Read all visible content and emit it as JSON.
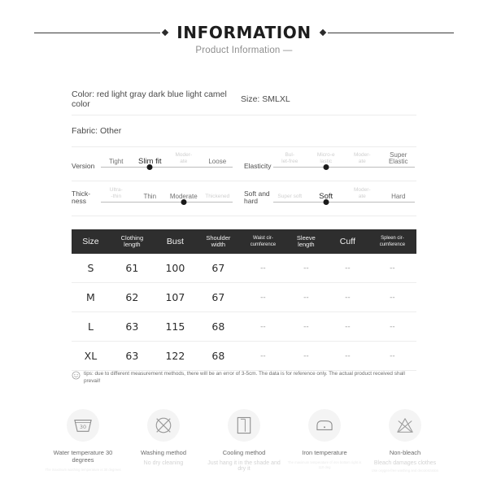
{
  "header": {
    "title": "INFORMATION",
    "subtitle": "Product Information —"
  },
  "info": {
    "color": "Color: red light gray dark blue light camel color",
    "size": "Size: SMLXL",
    "fabric": "Fabric: Other"
  },
  "attributes": [
    {
      "label": "Version",
      "ticks": [
        "Tight",
        "Slim fit",
        "Moder-\nate",
        "Loose"
      ],
      "selected_index": 1,
      "styles": [
        "mid",
        "on",
        "off",
        "mid"
      ]
    },
    {
      "label": "Elasticity",
      "ticks": [
        "Bul-\nlet-free",
        "Micro-e\nlastic",
        "Moder-\nate",
        "Super\nElastic"
      ],
      "selected_index": 1,
      "styles": [
        "off",
        "off",
        "off",
        "mid"
      ]
    },
    {
      "label": "Thick-\nness",
      "ticks": [
        "Ultra-\n-thin",
        "Thin",
        "Moderate",
        "Thickened"
      ],
      "selected_index": 2,
      "styles": [
        "off",
        "mid",
        "mid",
        "off"
      ]
    },
    {
      "label": "Soft and\nhard",
      "ticks": [
        "Super soft",
        "Soft",
        "Moder-\nate",
        "Hard"
      ],
      "selected_index": 1,
      "styles": [
        "off",
        "on",
        "off",
        "mid"
      ]
    }
  ],
  "table": {
    "headers": [
      {
        "text": "Size",
        "size": "lg"
      },
      {
        "text": "Clothing\nlength",
        "size": "md"
      },
      {
        "text": "Bust",
        "size": "lg"
      },
      {
        "text": "Shoulder\nwidth",
        "size": "md"
      },
      {
        "text": "Waist cir-\ncumference",
        "size": "sm"
      },
      {
        "text": "Sleeve\nlength",
        "size": "md"
      },
      {
        "text": "Cuff",
        "size": "lg"
      },
      {
        "text": "Spleen cir-\ncumference",
        "size": "sm"
      }
    ],
    "rows": [
      [
        "S",
        "61",
        "100",
        "67",
        "--",
        "--",
        "--",
        "--"
      ],
      [
        "M",
        "62",
        "107",
        "67",
        "--",
        "--",
        "--",
        "--"
      ],
      [
        "L",
        "63",
        "115",
        "68",
        "--",
        "--",
        "--",
        "--"
      ],
      [
        "XL",
        "63",
        "122",
        "68",
        "--",
        "--",
        "--",
        "--"
      ]
    ]
  },
  "tips": {
    "text": "tips: due to different measurement methods, there will be an error of 3-5cm. The data is for reference only. The actual product received shall prevail!"
  },
  "care": [
    {
      "icon": "wash-tub-30-icon",
      "title": "Water temperature 30 degrees",
      "sub": "",
      "sub2": "The maximum washing temperature is 30 degrees"
    },
    {
      "icon": "no-dry-clean-icon",
      "title": "Washing method",
      "sub": "No dry cleaning",
      "sub2": ""
    },
    {
      "icon": "hang-dry-icon",
      "title": "Cooling method",
      "sub": "Just hang it in the shade and dry it",
      "sub2": ""
    },
    {
      "icon": "iron-icon",
      "title": "Iron temperature",
      "sub": "",
      "sub2": "The maximum temperature of iron bottom right is 110 deg"
    },
    {
      "icon": "non-bleach-icon",
      "title": "Non-bleach",
      "sub": "Bleach damages clothes",
      "sub2": "Use oxygen-free washing and decolorization"
    }
  ],
  "colors": {
    "header_rule": "#3a3a3a",
    "table_header_bg": "#2e2e2e",
    "slider_dot": "#1a1a1a",
    "care_circle_bg": "#f4f4f4"
  }
}
